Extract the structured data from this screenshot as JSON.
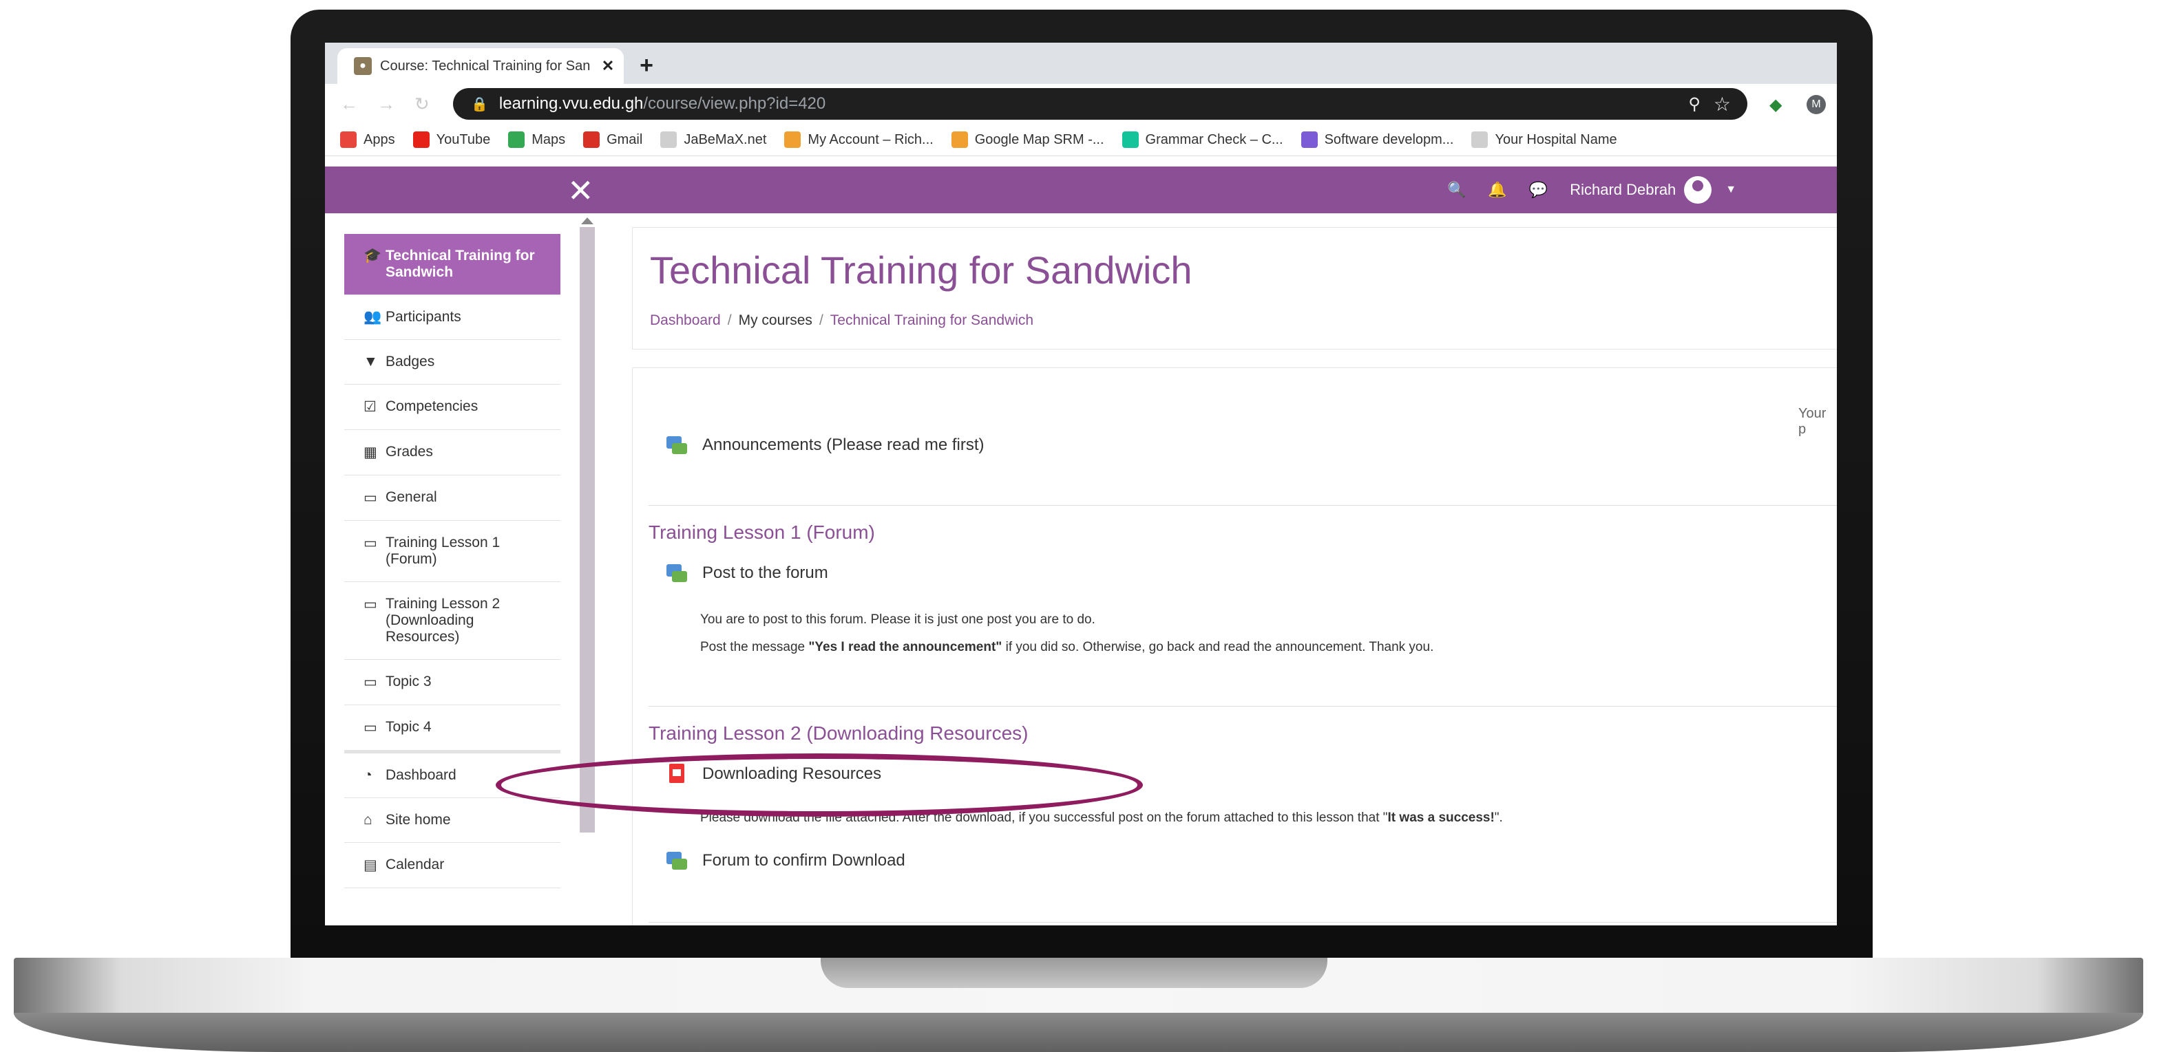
{
  "browser": {
    "tab_title": "Course: Technical Training for San",
    "url_host": "learning.vvu.edu.gh",
    "url_path": "/course/view.php?id=420",
    "bookmarks": [
      {
        "label": "Apps",
        "icon": "apps-grid-icon",
        "color": "#e8453c"
      },
      {
        "label": "YouTube",
        "icon": "youtube-icon",
        "color": "#e62117"
      },
      {
        "label": "Maps",
        "icon": "maps-icon",
        "color": "#34a853"
      },
      {
        "label": "Gmail",
        "icon": "gmail-icon",
        "color": "#d93025"
      },
      {
        "label": "JaBeMaX.net",
        "icon": "globe-icon",
        "color": "#cfcfcf"
      },
      {
        "label": "My Account – Rich...",
        "icon": "bookmark-site-icon",
        "color": "#f0a030"
      },
      {
        "label": "Google Map SRM -...",
        "icon": "bookmark-site-icon",
        "color": "#f0a030"
      },
      {
        "label": "Grammar Check – C...",
        "icon": "grammarly-icon",
        "color": "#15c39a"
      },
      {
        "label": "Software developm...",
        "icon": "software-icon",
        "color": "#7b5cd6"
      },
      {
        "label": "Your Hospital Name",
        "icon": "globe-icon",
        "color": "#cfcfcf"
      }
    ]
  },
  "navbar": {
    "user_name": "Richard Debrah",
    "brand_color": "#8a4f94"
  },
  "drawer": {
    "items": [
      {
        "label": "Technical Training for Sandwich",
        "icon": "graduation-cap-icon",
        "active": true
      },
      {
        "label": "Participants",
        "icon": "users-icon",
        "active": false
      },
      {
        "label": "Badges",
        "icon": "shield-icon",
        "active": false
      },
      {
        "label": "Competencies",
        "icon": "checkbox-icon",
        "active": false
      },
      {
        "label": "Grades",
        "icon": "table-icon",
        "active": false
      },
      {
        "label": "General",
        "icon": "folder-icon",
        "active": false
      },
      {
        "label": "Training Lesson 1 (Forum)",
        "icon": "folder-icon",
        "active": false
      },
      {
        "label": "Training Lesson 2 (Downloading Resources)",
        "icon": "folder-icon",
        "active": false
      },
      {
        "label": "Topic 3",
        "icon": "folder-icon",
        "active": false
      },
      {
        "label": "Topic 4",
        "icon": "folder-icon",
        "active": false
      },
      {
        "label": "Dashboard",
        "icon": "dashboard-icon",
        "active": false
      },
      {
        "label": "Site home",
        "icon": "home-icon",
        "active": false
      },
      {
        "label": "Calendar",
        "icon": "calendar-icon",
        "active": false
      }
    ]
  },
  "main": {
    "title": "Technical Training for Sandwich",
    "breadcrumb": [
      "Dashboard",
      "My courses",
      "Technical Training for Sandwich"
    ],
    "your_progress_fragment": "Your p",
    "general": {
      "activity": "Announcements (Please read me first)"
    },
    "lesson1": {
      "title": "Training Lesson 1 (Forum)",
      "activity": "Post to the forum",
      "desc_line1": "You are to post to this forum. Please it is just one post you are to do.",
      "desc_line2_pre": "Post the message ",
      "desc_line2_bold": "\"Yes I read the announcement\"",
      "desc_line2_post": " if you did so. Otherwise, go back and read the announcement. Thank you."
    },
    "lesson2": {
      "title": "Training Lesson 2 (Downloading Resources)",
      "activity": "Downloading Resources",
      "desc_pre": "Please download the file attached. After the download, if you successful post on the forum attached to this lesson that \"",
      "desc_bold": "It was a success!",
      "desc_post": "\".",
      "activity2": "Forum to confirm Download"
    }
  }
}
